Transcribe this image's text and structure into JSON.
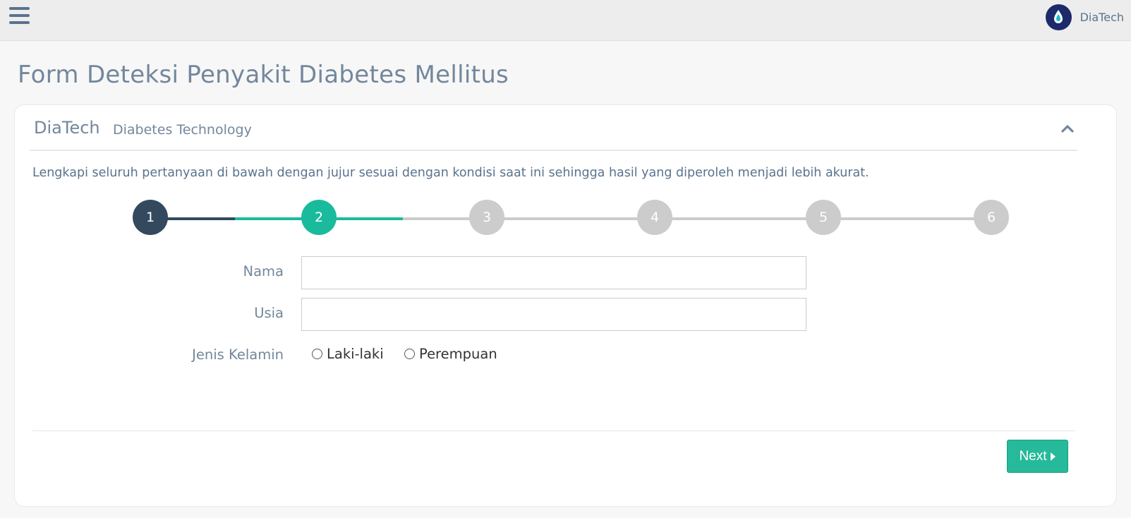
{
  "header": {
    "brand_name": "DiaTech",
    "menu_icon": "hamburger-menu-icon",
    "logo_icon": "diatech-logo"
  },
  "page": {
    "title": "Form Deteksi Penyakit Diabetes Mellitus"
  },
  "panel": {
    "title": "DiaTech",
    "subtitle": "Diabetes Technology",
    "collapse_icon": "chevron-up-icon",
    "intro": "Lengkapi seluruh pertanyaan di bawah dengan jujur sesuai dengan kondisi saat ini sehingga hasil yang diperoleh menjadi lebih akurat."
  },
  "stepper": {
    "steps": [
      "1",
      "2",
      "3",
      "4",
      "5",
      "6"
    ],
    "current_step": 2,
    "colors": {
      "done": "#34495e",
      "active": "#1abb9c",
      "pending": "#cccccc"
    }
  },
  "form": {
    "name_label": "Nama",
    "name_value": "",
    "age_label": "Usia",
    "age_value": "",
    "gender_label": "Jenis Kelamin",
    "gender_options": [
      "Laki-laki",
      "Perempuan"
    ]
  },
  "actions": {
    "next_label": "Next",
    "next_icon": "caret-right-icon",
    "accent_color": "#26b99a"
  }
}
